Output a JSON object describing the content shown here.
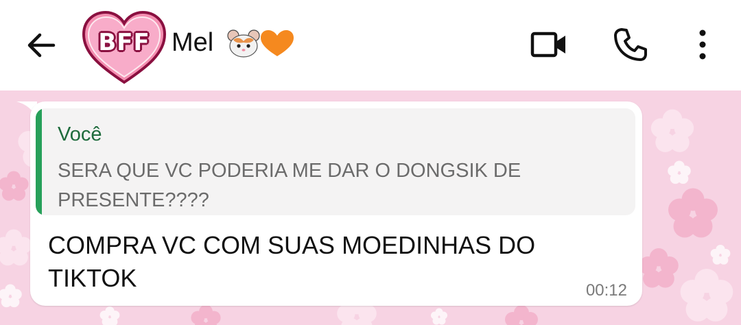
{
  "header": {
    "back_icon": "arrow-left-icon",
    "avatar_text": "BFF",
    "contact_name": "Mel",
    "name_emojis": [
      "hamster-emoji",
      "orange-heart-emoji"
    ],
    "video_icon": "video-camera-icon",
    "call_icon": "phone-icon",
    "menu_icon": "more-vertical-icon"
  },
  "colors": {
    "wallpaper": "#f7d3e3",
    "quote_bar": "#27a05a",
    "quote_author": "#1e6b3c",
    "avatar_heart": "#f48fb1"
  },
  "message": {
    "reply": {
      "author": "Você",
      "text": "SERA QUE VC PODERIA ME DAR O DONGSIK DE PRESENTE????"
    },
    "text": "COMPRA VC COM SUAS MOEDINHAS DO TIKTOK",
    "time": "00:12"
  }
}
